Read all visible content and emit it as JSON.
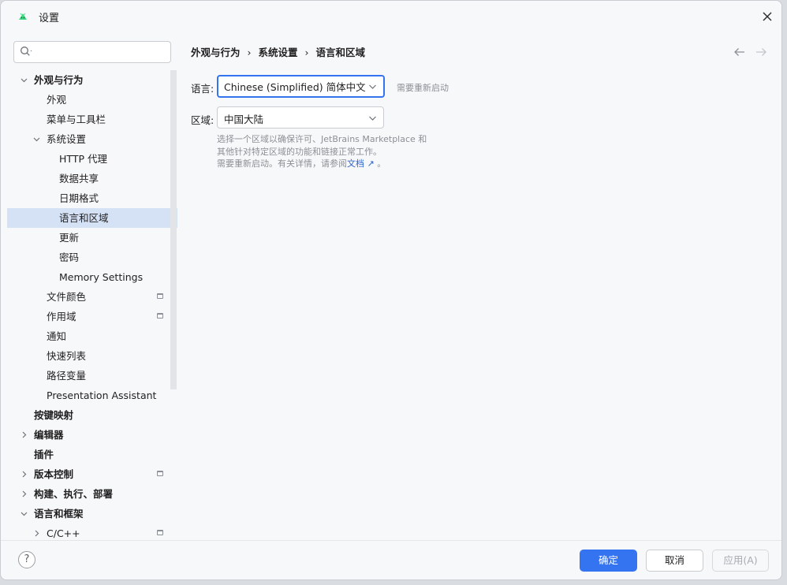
{
  "window": {
    "title": "设置"
  },
  "search": {
    "placeholder": "",
    "value": ""
  },
  "sidebar": {
    "items": [
      {
        "label": "外观与行为"
      },
      {
        "label": "外观"
      },
      {
        "label": "菜单与工具栏"
      },
      {
        "label": "系统设置"
      },
      {
        "label": "HTTP 代理"
      },
      {
        "label": "数据共享"
      },
      {
        "label": "日期格式"
      },
      {
        "label": "语言和区域"
      },
      {
        "label": "更新"
      },
      {
        "label": "密码"
      },
      {
        "label": "Memory Settings"
      },
      {
        "label": "文件颜色"
      },
      {
        "label": "作用域"
      },
      {
        "label": "通知"
      },
      {
        "label": "快速列表"
      },
      {
        "label": "路径变量"
      },
      {
        "label": "Presentation Assistant"
      },
      {
        "label": "按键映射"
      },
      {
        "label": "编辑器"
      },
      {
        "label": "插件"
      },
      {
        "label": "版本控制"
      },
      {
        "label": "构建、执行、部署"
      },
      {
        "label": "语言和框架"
      },
      {
        "label": "C/C++"
      }
    ]
  },
  "breadcrumb": {
    "part1": "外观与行为",
    "part2": "系统设置",
    "part3": "语言和区域",
    "separator": "›"
  },
  "language": {
    "label": "语言:",
    "value": "Chinese (Simplified) 简体中文",
    "hint": "需要重新启动"
  },
  "region": {
    "label": "区域:",
    "value": "中国大陆",
    "desc_line1": "选择一个区域以确保许可、JetBrains Marketplace 和",
    "desc_line2": "其他针对特定区域的功能和链接正常工作。",
    "desc_line3_prefix": "需要重新启动。有关详情，请参阅",
    "desc_link": "文档 ↗",
    "desc_line3_suffix": " 。"
  },
  "footer": {
    "help": "?",
    "ok": "确定",
    "cancel": "取消",
    "apply": "应用(A)"
  },
  "colors": {
    "accent": "#3574f0",
    "selection": "#d5e1f5",
    "link": "#2e62c9"
  }
}
